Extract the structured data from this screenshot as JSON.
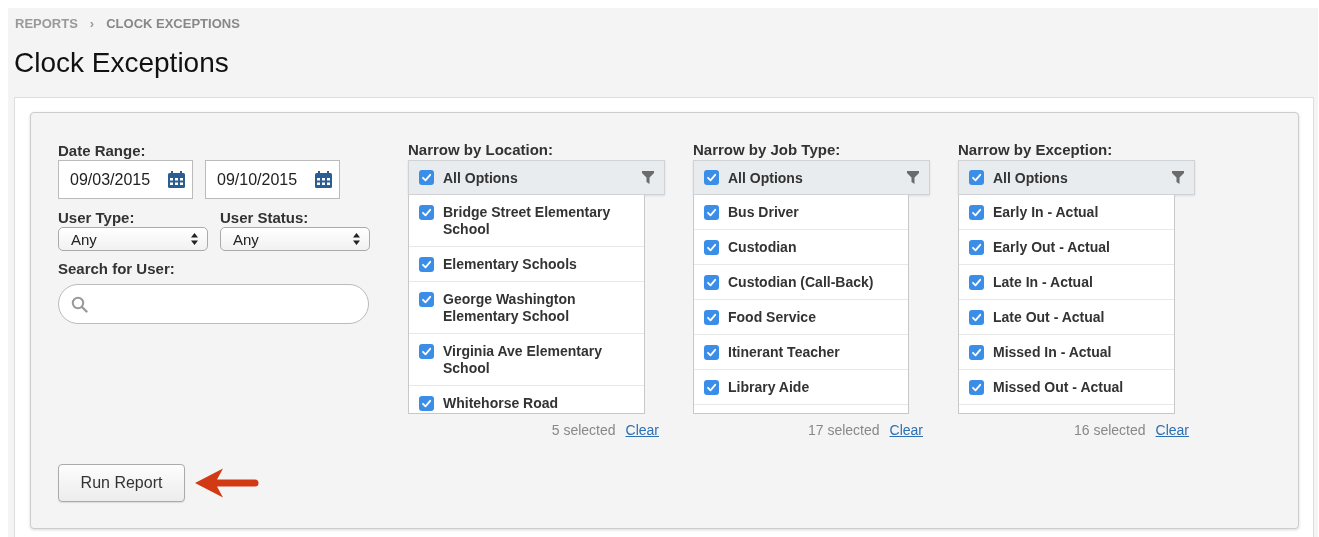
{
  "breadcrumb": [
    {
      "label": "REPORTS"
    },
    {
      "label": "›"
    },
    {
      "label": "CLOCK EXCEPTIONS"
    }
  ],
  "title": "Clock Exceptions",
  "date_range": {
    "label": "Date Range:",
    "start": "09/03/2015",
    "end": "09/10/2015"
  },
  "user_type": {
    "label": "User Type:",
    "value": "Any"
  },
  "user_status": {
    "label": "User Status:",
    "value": "Any"
  },
  "search": {
    "label": "Search for User:"
  },
  "filters": [
    {
      "title": "Narrow by Location:",
      "all": {
        "label": "All Options",
        "checked": true
      },
      "count": "5 selected",
      "clear": "Clear",
      "options": [
        {
          "label": "Bridge Street Elementary School",
          "checked": true
        },
        {
          "label": "Elementary Schools",
          "checked": true
        },
        {
          "label": "George Washington Elementary School",
          "checked": true
        },
        {
          "label": "Virginia Ave Elementary School",
          "checked": true
        },
        {
          "label": "Whitehorse Road",
          "checked": true
        }
      ]
    },
    {
      "title": "Narrow by Job Type:",
      "all": {
        "label": "All Options",
        "checked": true
      },
      "count": "17 selected",
      "clear": "Clear",
      "options": [
        {
          "label": "Bus Driver",
          "checked": true
        },
        {
          "label": "Custodian",
          "checked": true
        },
        {
          "label": "Custodian (Call-Back)",
          "checked": true
        },
        {
          "label": "Food Service",
          "checked": true
        },
        {
          "label": "Itinerant Teacher",
          "checked": true
        },
        {
          "label": "Library Aide",
          "checked": true
        }
      ]
    },
    {
      "title": "Narrow by Exception:",
      "all": {
        "label": "All Options",
        "checked": true
      },
      "count": "16 selected",
      "clear": "Clear",
      "options": [
        {
          "label": "Early In - Actual",
          "checked": true
        },
        {
          "label": "Early Out - Actual",
          "checked": true
        },
        {
          "label": "Late In - Actual",
          "checked": true
        },
        {
          "label": "Late Out - Actual",
          "checked": true
        },
        {
          "label": "Missed In - Actual",
          "checked": true
        },
        {
          "label": "Missed Out - Actual",
          "checked": true
        }
      ]
    }
  ],
  "run_button": "Run Report"
}
